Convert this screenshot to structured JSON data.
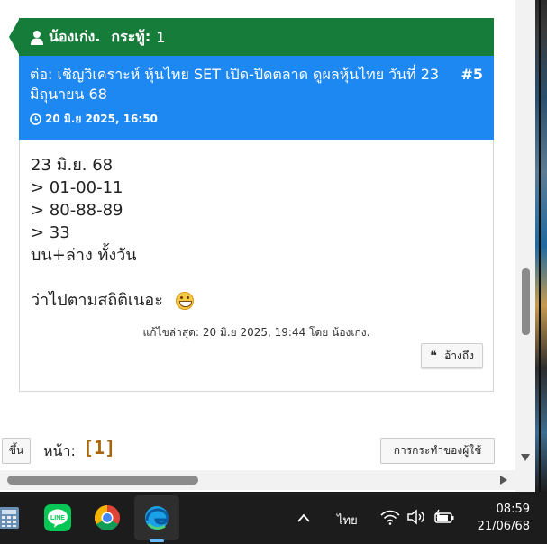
{
  "ribbon": {
    "username": "น้องเก่ง.",
    "posts_label": "กระทู้:",
    "posts_value": "1"
  },
  "post": {
    "title": "ต่อ: เชิญวิเคราะห์ หุ้นไทย SET เปิด-ปิดตลาด ดูผลหุ้นไทย วันที่ 23 มิถุนายน 68",
    "number": "#5",
    "date": "20 มิ.ย 2025, 16:50",
    "lines": [
      "23 มิ.ย. 68",
      "> 01-00-11",
      "> 80-88-89",
      "> 33",
      "บน+ล่าง ทั้งวัน"
    ],
    "signature": "ว่าไปตามสถิติเนอะ",
    "edit_note": "แก้ไขล่าสุด: 20 มิ.ย 2025, 19:44 โดย น้องเก่ง.",
    "quote_label": "อ้างถึง",
    "quote_glyph": "❝"
  },
  "toolbar": {
    "up_label": "ขึ้น",
    "page_label": "หน้า:",
    "page_number": "[1]",
    "actions_label": "การกระทำของผู้ใช้"
  },
  "colors": {
    "ribbon": "#167c3a",
    "post_header": "#1e88f2",
    "page_number": "#a8640a",
    "taskbar": "#1c1c1c"
  },
  "taskbar": {
    "apps": [
      "calculator-icon",
      "line-icon",
      "chrome-icon",
      "edge-icon"
    ],
    "language": "ไทย",
    "time": "08:59",
    "date": "21/06/68"
  }
}
